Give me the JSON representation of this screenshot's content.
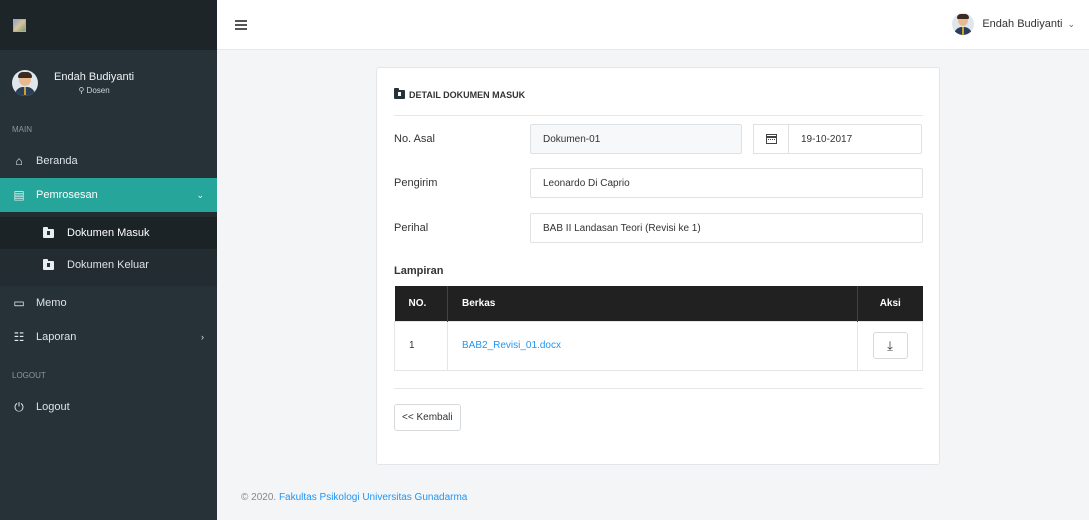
{
  "header": {
    "user_name": "Endah Budiyanti",
    "caret": "⌄"
  },
  "sidebar": {
    "profile": {
      "name": "Endah Budiyanti",
      "role": "Dosen"
    },
    "section_main": "MAIN",
    "section_logout": "LOGOUT",
    "items": {
      "beranda": "Beranda",
      "pemrosesan": "Pemrosesan",
      "dokumen_masuk": "Dokumen Masuk",
      "dokumen_keluar": "Dokumen Keluar",
      "memo": "Memo",
      "laporan": "Laporan",
      "logout": "Logout"
    }
  },
  "card": {
    "title": "DETAIL DOKUMEN MASUK",
    "fields": {
      "no_asal_label": "No. Asal",
      "no_asal_value": "Dokumen-01",
      "date_value": "19-10-2017",
      "pengirim_label": "Pengirim",
      "pengirim_value": "Leonardo Di Caprio",
      "perihal_label": "Perihal",
      "perihal_value": "BAB II Landasan Teori (Revisi ke 1)"
    },
    "lampiran_label": "Lampiran",
    "table": {
      "headers": [
        "NO.",
        "Berkas",
        "Aksi"
      ],
      "rows": [
        {
          "no": "1",
          "berkas": "BAB2_Revisi_01.docx"
        }
      ]
    },
    "back_label": "<< Kembali"
  },
  "footer": {
    "prefix": "© 2020.",
    "link": "Fakultas Psikologi Universitas Gunadarma"
  },
  "colors": {
    "accent": "#26a69a",
    "sidebar": "#263238",
    "link": "#2196f3"
  }
}
